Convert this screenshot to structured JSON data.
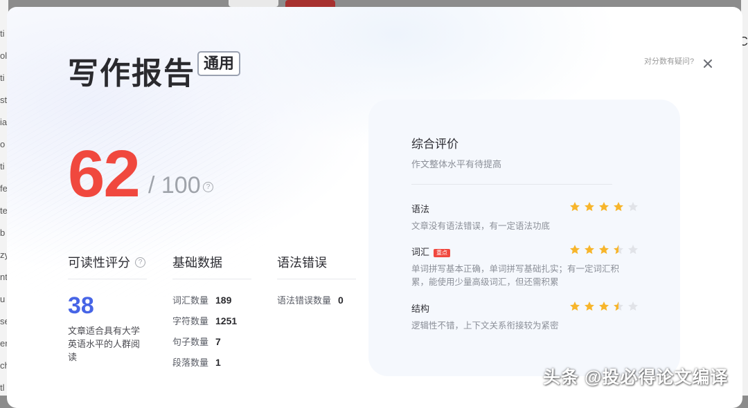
{
  "background": {
    "left_fragments": [
      "ti",
      "ol",
      "ti",
      "st",
      "ia",
      "o",
      "ti",
      "fe",
      "te",
      "b",
      "zy",
      "nt",
      "u",
      "se",
      "er",
      "ch",
      "tl"
    ],
    "right_fragment": "C"
  },
  "report": {
    "title": "写作报告",
    "badge": "通用",
    "question_link": "对分数有疑问?",
    "score": "62",
    "score_total": "/ 100",
    "help_glyph": "?"
  },
  "readability": {
    "title": "可读性评分",
    "value": "38",
    "description": "文章适合具有大学英语水平的人群阅读"
  },
  "basic_data": {
    "title": "基础数据",
    "rows": [
      {
        "label": "词汇数量",
        "value": "189"
      },
      {
        "label": "字符数量",
        "value": "1251"
      },
      {
        "label": "句子数量",
        "value": "7"
      },
      {
        "label": "段落数量",
        "value": "1"
      }
    ]
  },
  "grammar_errors": {
    "title": "语法错误",
    "rows": [
      {
        "label": "语法错误数量",
        "value": "0"
      }
    ]
  },
  "evaluation": {
    "title": "综合评价",
    "subtitle": "作文整体水平有待提高",
    "categories": [
      {
        "name": "语法",
        "tag": "",
        "rating": 4,
        "max": 5,
        "description": "文章没有语法错误，有一定语法功底"
      },
      {
        "name": "词汇",
        "tag": "重点",
        "rating": 3.5,
        "max": 5,
        "description": "单词拼写基本正确，单词拼写基础扎实；有一定词汇积累，能使用少量高级词汇，但还需积累"
      },
      {
        "name": "结构",
        "tag": "",
        "rating": 3.5,
        "max": 5,
        "description": "逻辑性不错，上下文关系衔接较为紧密"
      }
    ]
  },
  "colors": {
    "score": "#f0483e",
    "readability": "#4765e6",
    "star_on": "#f7b52b",
    "star_off": "#e1e3e8",
    "tag": "#f0483e"
  },
  "watermark": "头条 @投必得论文编译"
}
